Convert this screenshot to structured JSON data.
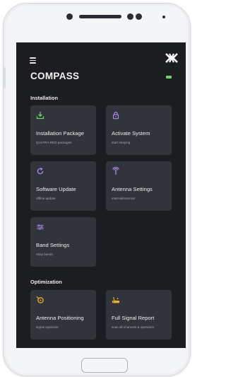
{
  "app": {
    "title": "COMPASS"
  },
  "sections": [
    {
      "title": "Installation",
      "tiles": [
        {
          "title": "Installation Package",
          "subtitle": "QUATRA RED packages",
          "icon": "download-icon"
        },
        {
          "title": "Activate System",
          "subtitle": "start relaying",
          "icon": "lock-icon"
        },
        {
          "title": "Software Update",
          "subtitle": "offline update",
          "icon": "refresh-icon"
        },
        {
          "title": "Antenna Settings",
          "subtitle": "internal/external",
          "icon": "antenna-icon"
        },
        {
          "title": "Band Settings",
          "subtitle": "relay bands",
          "icon": "sliders-icon"
        }
      ]
    },
    {
      "title": "Optimization",
      "tiles": [
        {
          "title": "Antenna Positioning",
          "subtitle": "signal optimizer",
          "icon": "compass-icon"
        },
        {
          "title": "Full Signal Report",
          "subtitle": "scan all channels & operators",
          "icon": "router-icon"
        }
      ]
    }
  ],
  "colors": {
    "background": "#1b1d21",
    "tile": "#31343a",
    "accent_green": "#6dd36a",
    "accent_purple": "#a98cf0",
    "accent_yellow": "#f2b020"
  }
}
